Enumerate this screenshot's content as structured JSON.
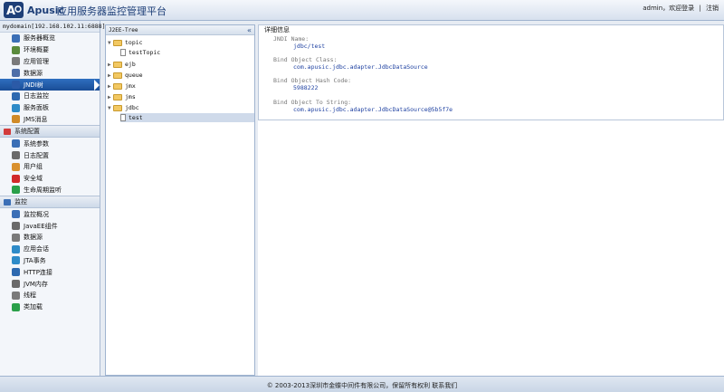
{
  "header": {
    "brand": "Apusic",
    "platform": "应用服务器监控管理平台",
    "user": "admin，欢迎登录",
    "divider": "|",
    "logout": "注销"
  },
  "sidebar": {
    "domain": "mydomain[192.168.102.11:6888]",
    "group1": [
      {
        "label": "服务器概览",
        "icon": "server-icon",
        "color": "#3b6fb6"
      },
      {
        "label": "环境概要",
        "icon": "environment-icon",
        "color": "#5a8a3c"
      },
      {
        "label": "应用管理",
        "icon": "application-icon",
        "color": "#7a7a7a"
      },
      {
        "label": "数据源",
        "icon": "datasource-icon",
        "color": "#4f6fa8"
      },
      {
        "label": "JNDI树",
        "icon": "jndi-tree-icon",
        "color": "#2b5aa7",
        "active": true
      },
      {
        "label": "日志监控",
        "icon": "log-monitor-icon",
        "color": "#2d69b0"
      },
      {
        "label": "服务面板",
        "icon": "service-panel-icon",
        "color": "#2e8bc8"
      },
      {
        "label": "JMS消息",
        "icon": "jms-message-icon",
        "color": "#d08a28"
      }
    ],
    "section2": "系统配置",
    "group2": [
      {
        "label": "系统参数",
        "icon": "system-params-icon",
        "color": "#3b6fb6"
      },
      {
        "label": "日志配置",
        "icon": "log-config-icon",
        "color": "#6a6a6a"
      },
      {
        "label": "用户组",
        "icon": "user-group-icon",
        "color": "#d9912f"
      },
      {
        "label": "安全域",
        "icon": "security-domain-icon",
        "color": "#d12a2a"
      },
      {
        "label": "生命周期监听",
        "icon": "lifecycle-icon",
        "color": "#2aa04a"
      }
    ],
    "section3": "监控",
    "group3": [
      {
        "label": "监控概况",
        "icon": "monitor-overview-icon",
        "color": "#3b6fb6"
      },
      {
        "label": "JavaEE组件",
        "icon": "javaee-icon",
        "color": "#6a6a6a"
      },
      {
        "label": "数据源",
        "icon": "datasource-icon",
        "color": "#7a7a7a"
      },
      {
        "label": "应用会话",
        "icon": "session-icon",
        "color": "#2e8bc8"
      },
      {
        "label": "JTA事务",
        "icon": "jta-icon",
        "color": "#2e8bc8"
      },
      {
        "label": "HTTP连接",
        "icon": "http-icon",
        "color": "#2d69b0"
      },
      {
        "label": "JVM内存",
        "icon": "jvm-memory-icon",
        "color": "#6a6a6a"
      },
      {
        "label": "线程",
        "icon": "thread-icon",
        "color": "#7a7a7a"
      },
      {
        "label": "类加载",
        "icon": "classloader-icon",
        "color": "#2aa04a"
      }
    ]
  },
  "tree": {
    "title": "J2EE-Tree",
    "collapse": "«",
    "nodes": {
      "topic": "topic",
      "testTopic": "testTopic",
      "ejb": "ejb",
      "queue": "queue",
      "jmx": "jmx",
      "jms": "jms",
      "jdbc": "jdbc",
      "test": "test"
    }
  },
  "details": {
    "legend": "详细信息",
    "jndi_name_label": "JNDI Name:",
    "jndi_name": "jdbc/test",
    "bind_class_label": "Bind Object Class:",
    "bind_class": "com.apusic.jdbc.adapter.JdbcDataSource",
    "hash_label": "Bind Object Hash Code:",
    "hash": "5988222",
    "to_string_label": "Bind Object To String:",
    "to_string": "com.apusic.jdbc.adapter.JdbcDataSource@5b5f7e"
  },
  "footer": "© 2003-2013深圳市金蝶中间件有限公司，保留所有权利  联系我们"
}
